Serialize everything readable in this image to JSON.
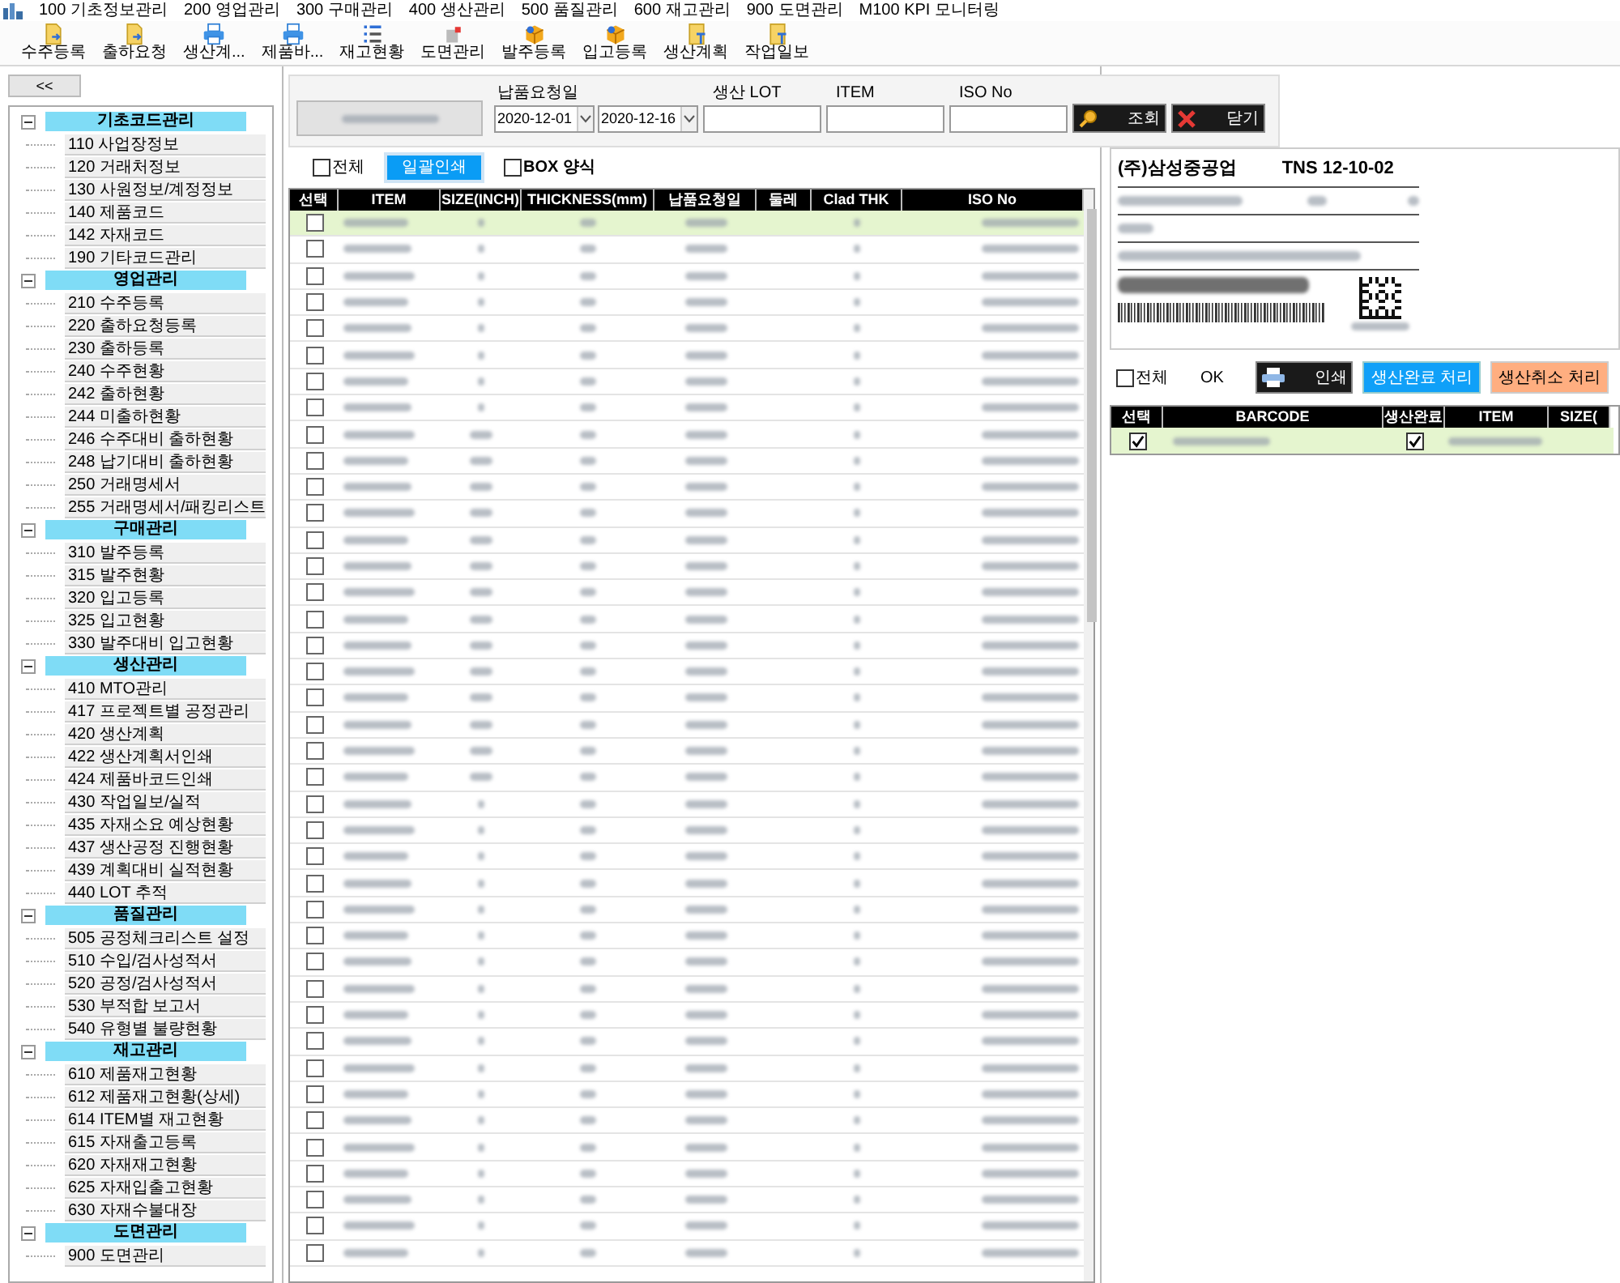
{
  "menu_bar": {
    "items": [
      "100 기초정보관리",
      "200 영업관리",
      "300 구매관리",
      "400 생산관리",
      "500 품질관리",
      "600 재고관리",
      "900 도면관리",
      "M100 KPI 모니터링"
    ]
  },
  "toolbar": {
    "buttons": [
      {
        "label": "수주등록",
        "kind": "doc"
      },
      {
        "label": "출하요청",
        "kind": "doc"
      },
      {
        "label": "생산계...",
        "kind": "printer"
      },
      {
        "label": "제품바...",
        "kind": "printer"
      },
      {
        "label": "재고현황",
        "kind": "list"
      },
      {
        "label": "도면관리",
        "kind": "drawing"
      },
      {
        "label": "발주등록",
        "kind": "box"
      },
      {
        "label": "입고등록",
        "kind": "box"
      },
      {
        "label": "생산계획",
        "kind": "report"
      },
      {
        "label": "작업일보",
        "kind": "report"
      }
    ]
  },
  "sidebar": {
    "collapse_button": "<<",
    "groups": [
      {
        "label": "기초코드관리",
        "expanded": true,
        "children": [
          {
            "label": "110 사업장정보"
          },
          {
            "label": "120 거래처정보"
          },
          {
            "label": "130 사원정보/계정정보"
          },
          {
            "label": "140 제품코드"
          },
          {
            "label": "142 자재코드"
          },
          {
            "label": "190 기타코드관리"
          }
        ]
      },
      {
        "label": "영업관리",
        "expanded": true,
        "children": [
          {
            "label": "210 수주등록"
          },
          {
            "label": "220 출하요청등록"
          },
          {
            "label": "230 출하등록"
          },
          {
            "label": "240 수주현황"
          },
          {
            "label": "242 출하현황"
          },
          {
            "label": "244 미출하현황"
          },
          {
            "label": "246 수주대비 출하현황"
          },
          {
            "label": "248 납기대비 출하현황"
          },
          {
            "label": "250 거래명세서"
          },
          {
            "label": "255 거래명세서/패킹리스트"
          }
        ]
      },
      {
        "label": "구매관리",
        "expanded": true,
        "children": [
          {
            "label": "310 발주등록"
          },
          {
            "label": "315 발주현황"
          },
          {
            "label": "320 입고등록"
          },
          {
            "label": "325 입고현황"
          },
          {
            "label": "330 발주대비 입고현황"
          }
        ]
      },
      {
        "label": "생산관리",
        "expanded": true,
        "children": [
          {
            "label": "410 MTO관리"
          },
          {
            "label": "417 프로젝트별 공정관리"
          },
          {
            "label": "420 생산계획"
          },
          {
            "label": "422 생산계획서인쇄"
          },
          {
            "label": "424 제품바코드인쇄"
          },
          {
            "label": "430 작업일보/실적"
          },
          {
            "label": "435 자재소요 예상현황"
          },
          {
            "label": "437 생산공정 진행현황"
          },
          {
            "label": "439 계획대비 실적현황"
          },
          {
            "label": "440 LOT 추적"
          }
        ]
      },
      {
        "label": "품질관리",
        "expanded": true,
        "children": [
          {
            "label": "505 공정체크리스트 설정"
          },
          {
            "label": "510 수입/검사성적서"
          },
          {
            "label": "520 공정/검사성적서"
          },
          {
            "label": "530 부적합 보고서"
          },
          {
            "label": "540 유형별 불량현황"
          }
        ]
      },
      {
        "label": "재고관리",
        "expanded": true,
        "children": [
          {
            "label": "610 제품재고현황"
          },
          {
            "label": "612 제품재고현황(상세)"
          },
          {
            "label": "614 ITEM별 재고현황"
          },
          {
            "label": "615 자재출고등록"
          },
          {
            "label": "620 자재재고현황"
          },
          {
            "label": "625 자재입출고현황"
          },
          {
            "label": "630 자재수불대장"
          }
        ]
      },
      {
        "label": "도면관리",
        "expanded": true,
        "children": [
          {
            "label": "900 도면관리"
          }
        ]
      }
    ]
  },
  "filter": {
    "date_label": "납품요청일",
    "date_from": "2020-12-01",
    "date_to": "2020-12-16",
    "lot_label": "생산 LOT",
    "item_label": "ITEM",
    "iso_label": "ISO No",
    "search_button": "조회",
    "close_button": "닫기"
  },
  "options": {
    "select_all": {
      "label": "전체",
      "checked": false
    },
    "batch_print": "일괄인쇄",
    "box_mode": {
      "label": "BOX 양식",
      "checked": false
    }
  },
  "table": {
    "columns": [
      "선택",
      "ITEM",
      "SIZE(INCH)",
      "THICKNESS(mm)",
      "납품요청일",
      "둘레",
      "Clad THK",
      "ISO No"
    ],
    "rows": [
      {
        "selected": true,
        "checked": false
      },
      {
        "selected": false,
        "checked": false
      },
      {
        "selected": false,
        "checked": false
      },
      {
        "selected": false,
        "checked": false
      },
      {
        "selected": false,
        "checked": false
      },
      {
        "selected": false,
        "checked": false
      },
      {
        "selected": false,
        "checked": false
      },
      {
        "selected": false,
        "checked": false
      },
      {
        "selected": false,
        "checked": false
      },
      {
        "selected": false,
        "checked": false
      },
      {
        "selected": false,
        "checked": false
      },
      {
        "selected": false,
        "checked": false
      },
      {
        "selected": false,
        "checked": false
      },
      {
        "selected": false,
        "checked": false
      },
      {
        "selected": false,
        "checked": false
      },
      {
        "selected": false,
        "checked": false
      },
      {
        "selected": false,
        "checked": false
      },
      {
        "selected": false,
        "checked": false
      },
      {
        "selected": false,
        "checked": false
      },
      {
        "selected": false,
        "checked": false
      },
      {
        "selected": false,
        "checked": false
      },
      {
        "selected": false,
        "checked": false
      },
      {
        "selected": false,
        "checked": false
      },
      {
        "selected": false,
        "checked": false
      },
      {
        "selected": false,
        "checked": false
      },
      {
        "selected": false,
        "checked": false
      },
      {
        "selected": false,
        "checked": false
      },
      {
        "selected": false,
        "checked": false
      },
      {
        "selected": false,
        "checked": false
      },
      {
        "selected": false,
        "checked": false
      },
      {
        "selected": false,
        "checked": false
      },
      {
        "selected": false,
        "checked": false
      },
      {
        "selected": false,
        "checked": false
      },
      {
        "selected": false,
        "checked": false
      },
      {
        "selected": false,
        "checked": false
      },
      {
        "selected": false,
        "checked": false
      },
      {
        "selected": false,
        "checked": false
      },
      {
        "selected": false,
        "checked": false
      },
      {
        "selected": false,
        "checked": false
      },
      {
        "selected": false,
        "checked": false
      }
    ]
  },
  "label_preview": {
    "company": "(주)삼성중공업",
    "code": "TNS 12-10-02"
  },
  "right_actions": {
    "select_all": {
      "label": "전체",
      "checked": false
    },
    "ok": "OK",
    "print_button": "인쇄",
    "complete_button": "생산완료 처리",
    "cancel_button": "생산취소 처리"
  },
  "barcode_table": {
    "columns": [
      "선택",
      "BARCODE",
      "생산완료",
      "ITEM",
      "SIZE("
    ],
    "rows": [
      {
        "selected": true,
        "checked": true,
        "done": true
      }
    ]
  }
}
